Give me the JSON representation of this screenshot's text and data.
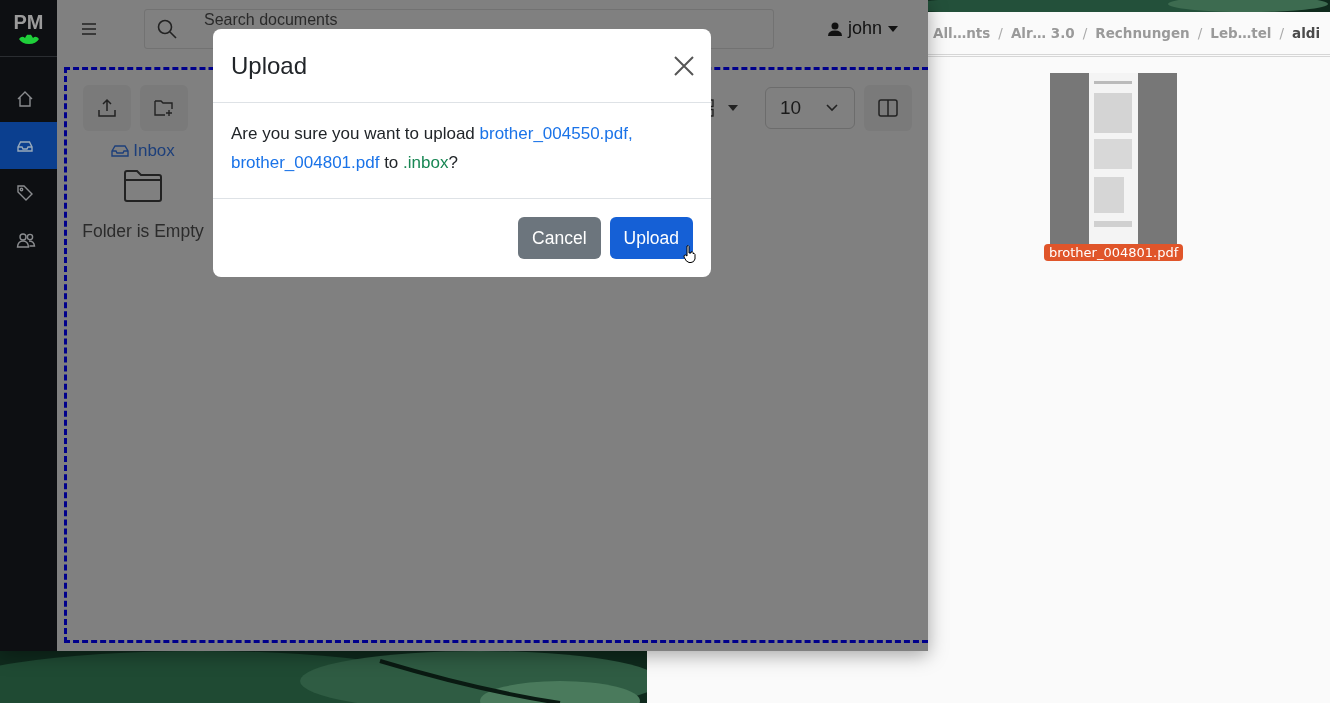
{
  "browser": {
    "logo": "PM",
    "sidebar": {
      "items": [
        {
          "kind": "home",
          "selected": false
        },
        {
          "kind": "inbox",
          "selected": true
        },
        {
          "kind": "tag",
          "selected": false
        },
        {
          "kind": "users",
          "selected": false
        }
      ]
    },
    "topbar": {
      "search": {
        "placeholder": "Search documents"
      },
      "user": "john"
    },
    "toolbar": {
      "page_size": "10"
    },
    "folder": {
      "name": "Inbox",
      "empty_message": "Folder is Empty"
    }
  },
  "dialog": {
    "title": "Upload",
    "message": [
      {
        "text": "Are you sure you want to upload ",
        "kind": "plain"
      },
      {
        "text": "brother_004550.pdf, brother_004801.pdf",
        "kind": "file"
      },
      {
        "text": " to ",
        "kind": "plain"
      },
      {
        "text": ".inbox",
        "kind": "folder"
      },
      {
        "text": "?",
        "kind": "plain"
      }
    ],
    "buttons": [
      {
        "label": "Cancel",
        "kind": "secondary"
      },
      {
        "label": "Upload",
        "kind": "primary"
      }
    ]
  },
  "file_manager": {
    "breadcrumb": [
      {
        "label": "All…nts",
        "selected": false
      },
      {
        "label": "Alr… 3.0",
        "selected": false
      },
      {
        "label": "Rechnungen",
        "selected": false
      },
      {
        "label": "Leb…tel",
        "selected": false
      },
      {
        "label": "aldi",
        "selected": true
      }
    ],
    "separators": [
      "/",
      "/",
      "/",
      "/"
    ],
    "files": [
      {
        "name": "brother_004801.pdf",
        "selected": true
      }
    ]
  }
}
